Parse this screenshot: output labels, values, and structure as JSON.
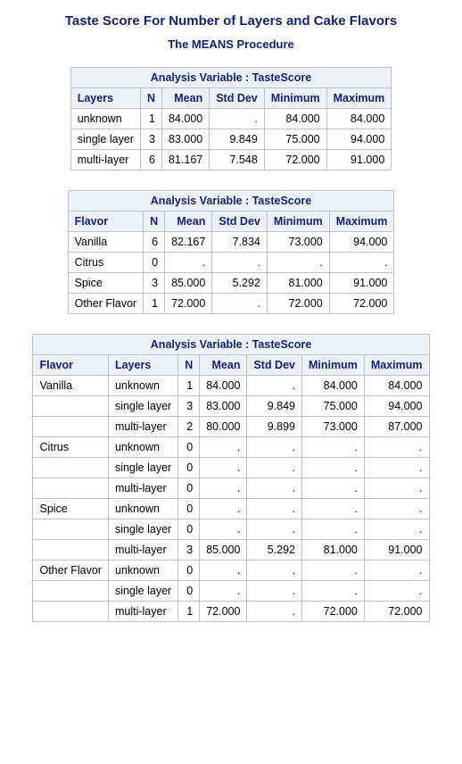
{
  "title": "Taste Score For Number of Layers and Cake Flavors",
  "subtitle": "The MEANS Procedure",
  "caption": "Analysis Variable : TasteScore",
  "columns": {
    "layers": "Layers",
    "flavor": "Flavor",
    "n": "N",
    "mean": "Mean",
    "stddev": "Std Dev",
    "min": "Minimum",
    "max": "Maximum"
  },
  "table1": {
    "rows": [
      {
        "layers": "unknown",
        "n": "1",
        "mean": "84.000",
        "stddev": ".",
        "min": "84.000",
        "max": "84.000"
      },
      {
        "layers": "single layer",
        "n": "3",
        "mean": "83.000",
        "stddev": "9.849",
        "min": "75.000",
        "max": "94.000"
      },
      {
        "layers": "multi-layer",
        "n": "6",
        "mean": "81.167",
        "stddev": "7.548",
        "min": "72.000",
        "max": "91.000"
      }
    ]
  },
  "table2": {
    "rows": [
      {
        "flavor": "Vanilla",
        "n": "6",
        "mean": "82.167",
        "stddev": "7.834",
        "min": "73.000",
        "max": "94.000"
      },
      {
        "flavor": "Citrus",
        "n": "0",
        "mean": ".",
        "stddev": ".",
        "min": ".",
        "max": "."
      },
      {
        "flavor": "Spice",
        "n": "3",
        "mean": "85.000",
        "stddev": "5.292",
        "min": "81.000",
        "max": "91.000"
      },
      {
        "flavor": "Other Flavor",
        "n": "1",
        "mean": "72.000",
        "stddev": ".",
        "min": "72.000",
        "max": "72.000"
      }
    ]
  },
  "table3": {
    "rows": [
      {
        "flavor": "Vanilla",
        "layers": "unknown",
        "n": "1",
        "mean": "84.000",
        "stddev": ".",
        "min": "84.000",
        "max": "84.000"
      },
      {
        "flavor": "",
        "layers": "single layer",
        "n": "3",
        "mean": "83.000",
        "stddev": "9.849",
        "min": "75.000",
        "max": "94.000"
      },
      {
        "flavor": "",
        "layers": "multi-layer",
        "n": "2",
        "mean": "80.000",
        "stddev": "9.899",
        "min": "73.000",
        "max": "87.000"
      },
      {
        "flavor": "Citrus",
        "layers": "unknown",
        "n": "0",
        "mean": ".",
        "stddev": ".",
        "min": ".",
        "max": "."
      },
      {
        "flavor": "",
        "layers": "single layer",
        "n": "0",
        "mean": ".",
        "stddev": ".",
        "min": ".",
        "max": "."
      },
      {
        "flavor": "",
        "layers": "multi-layer",
        "n": "0",
        "mean": ".",
        "stddev": ".",
        "min": ".",
        "max": "."
      },
      {
        "flavor": "Spice",
        "layers": "unknown",
        "n": "0",
        "mean": ".",
        "stddev": ".",
        "min": ".",
        "max": "."
      },
      {
        "flavor": "",
        "layers": "single layer",
        "n": "0",
        "mean": ".",
        "stddev": ".",
        "min": ".",
        "max": "."
      },
      {
        "flavor": "",
        "layers": "multi-layer",
        "n": "3",
        "mean": "85.000",
        "stddev": "5.292",
        "min": "81.000",
        "max": "91.000"
      },
      {
        "flavor": "Other Flavor",
        "layers": "unknown",
        "n": "0",
        "mean": ".",
        "stddev": ".",
        "min": ".",
        "max": "."
      },
      {
        "flavor": "",
        "layers": "single layer",
        "n": "0",
        "mean": ".",
        "stddev": ".",
        "min": ".",
        "max": "."
      },
      {
        "flavor": "",
        "layers": "multi-layer",
        "n": "1",
        "mean": "72.000",
        "stddev": ".",
        "min": "72.000",
        "max": "72.000"
      }
    ]
  }
}
